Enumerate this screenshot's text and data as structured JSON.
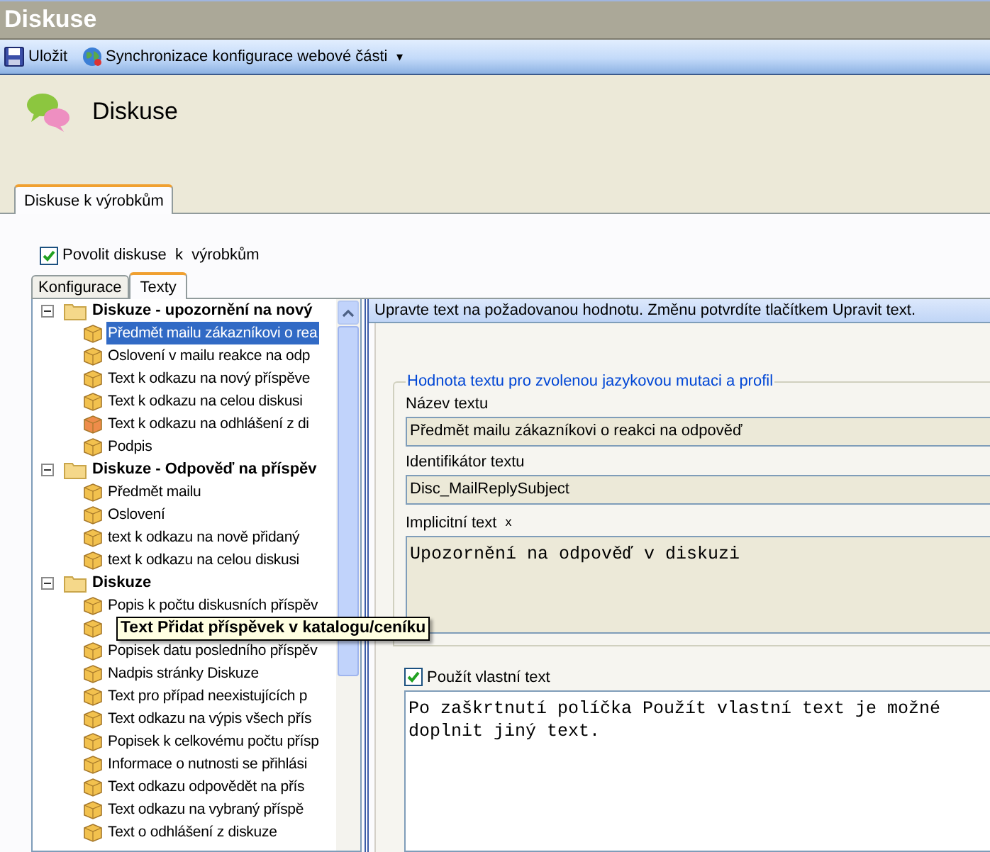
{
  "window": {
    "title": "Diskuse"
  },
  "toolbar": [
    {
      "kind": "save",
      "label": "Uložit"
    },
    {
      "kind": "sync",
      "label": "Synchronizace konfigurace webové části",
      "caret": "▾"
    }
  ],
  "header": {
    "title": "Diskuse"
  },
  "tabs": [
    {
      "label": "Diskuse k výrobkům",
      "selected": true
    }
  ],
  "enable": {
    "label": "Povolit diskuse  k  výrobkům",
    "checked": true
  },
  "subtabs": [
    {
      "label": "Konfigurace",
      "selected": false
    },
    {
      "label": "Texty",
      "selected": true
    }
  ],
  "tree": [
    {
      "label": "Diskuze - upozornění na nový",
      "expanded": true,
      "children": [
        {
          "label": "Předmět mailu zákazníkovi o rea",
          "selected": true,
          "color": "#f2c14e"
        },
        {
          "label": "Oslovení v mailu reakce na odp",
          "selected": false,
          "color": "#f2c14e"
        },
        {
          "label": "Text k odkazu na nový příspěve",
          "selected": false,
          "color": "#f2c14e"
        },
        {
          "label": "Text k odkazu na celou diskusi",
          "selected": false,
          "color": "#f2c14e"
        },
        {
          "label": "Text k odkazu na odhlášení z di",
          "selected": false,
          "color": "#ee8c4a"
        },
        {
          "label": "Podpis",
          "selected": false,
          "color": "#f2c14e"
        }
      ]
    },
    {
      "label": "Diskuze - Odpověď na příspěv",
      "expanded": true,
      "children": [
        {
          "label": "Předmět mailu",
          "selected": false,
          "color": "#f2c14e"
        },
        {
          "label": "Oslovení",
          "selected": false,
          "color": "#f2c14e"
        },
        {
          "label": "text k odkazu na nově přidaný",
          "selected": false,
          "color": "#f2c14e"
        },
        {
          "label": "text k odkazu na celou diskusi",
          "selected": false,
          "color": "#f2c14e"
        }
      ]
    },
    {
      "label": "Diskuze",
      "expanded": true,
      "children": [
        {
          "label": "Popis k počtu diskusních příspěv",
          "selected": false,
          "color": "#f2c14e"
        },
        {
          "tooltip": "Text Přidat příspěvek v katalogu/ceníku",
          "selected": false,
          "color": "#f2c14e"
        },
        {
          "label": "Popisek datu posledního příspěv",
          "selected": false,
          "color": "#f2c14e"
        },
        {
          "label": "Nadpis stránky Diskuze",
          "selected": false,
          "color": "#f2c14e"
        },
        {
          "label": "Text pro případ neexistujících p",
          "selected": false,
          "color": "#f2c14e"
        },
        {
          "label": "Text odkazu na výpis všech přís",
          "selected": false,
          "color": "#f2c14e"
        },
        {
          "label": "Popisek k celkovému počtu přísp",
          "selected": false,
          "color": "#f2c14e"
        },
        {
          "label": "Informace o nutnosti se přihlási",
          "selected": false,
          "color": "#f2c14e"
        },
        {
          "label": "Text odkazu odpovědět na přís",
          "selected": false,
          "color": "#f2c14e"
        },
        {
          "label": "Text odkazu na vybraný příspě",
          "selected": false,
          "color": "#f2c14e"
        },
        {
          "label": "Text o odhlášení z diskuze",
          "selected": false,
          "color": "#f2c14e"
        }
      ]
    }
  ],
  "editor": {
    "hint": "Upravte text na požadovanou hodnotu. Změnu potvrdíte tlačítkem Upravit text.",
    "legend": "Hodnota textu pro zvolenou jazykovou mutaci a profil",
    "fields": [
      {
        "label": "Název textu",
        "value": "Předmět mailu zákazníkovi o reakci na odpověď"
      },
      {
        "label": "Identifikátor textu",
        "value": "Disc_MailReplySubject"
      }
    ],
    "default": {
      "label": "Implicitní text",
      "mark": "x",
      "value": "Upozornění na odpověď v diskuzi"
    },
    "custom": {
      "label": "Použít vlastní text",
      "checked": true,
      "value": "Po zaškrtnutí políčka Použít vlastní text je možné doplnit jiný text."
    }
  }
}
